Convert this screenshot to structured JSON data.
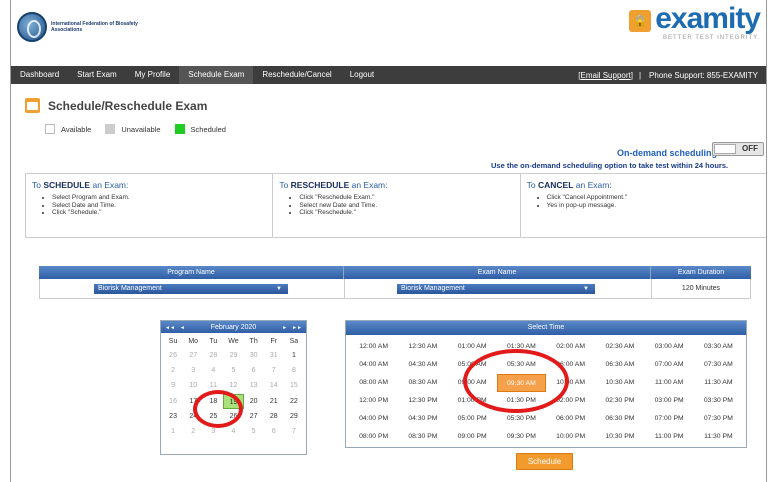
{
  "header": {
    "org_name": "International Federation of Biosafety Associations",
    "brand": "examity",
    "tagline": "BETTER TEST INTEGRITY."
  },
  "nav": {
    "items": [
      "Dashboard",
      "Start Exam",
      "My Profile",
      "Schedule Exam",
      "Reschedule/Cancel",
      "Logout"
    ],
    "active": "Schedule Exam",
    "email_support": "[Email Support]",
    "separator": "|",
    "phone_support": "Phone Support: 855-EXAMITY"
  },
  "page": {
    "title": "Schedule/Reschedule Exam"
  },
  "legend": {
    "available": "Available",
    "unavailable": "Unavailable",
    "scheduled": "Scheduled",
    "colors": {
      "available": "#ffffff",
      "unavailable": "#cccccc",
      "scheduled": "#22cc22"
    }
  },
  "ondemand": {
    "label": "On-demand scheduling",
    "toggle_state": "OFF",
    "note": "Use the on-demand scheduling option to take test within 24 hours."
  },
  "instructions": {
    "schedule": {
      "prefix": "To ",
      "action": "SCHEDULE",
      "suffix": " an Exam:",
      "steps": [
        "Select Program and Exam.",
        "Select Date and Time.",
        "Click \"Schedule.\""
      ]
    },
    "reschedule": {
      "prefix": "To ",
      "action": "RESCHEDULE",
      "suffix": " an Exam:",
      "steps": [
        "Click \"Reschedule Exam.\"",
        "Select new Date and Time.",
        "Click \"Reschedule.\""
      ]
    },
    "cancel": {
      "prefix": "To ",
      "action": "CANCEL",
      "suffix": " an Exam:",
      "steps": [
        "Click \"Cancel Appointment.\"",
        "Yes in pop-up message."
      ]
    }
  },
  "program_table": {
    "headers": [
      "Program Name",
      "Exam Name",
      "Exam Duration"
    ],
    "program_value": "Biorisk Management",
    "exam_value": "Biorisk Management",
    "duration": "120 Minutes"
  },
  "calendar": {
    "month_label": "February 2020",
    "nav_prev_year": "◄◄",
    "nav_prev": "◄",
    "nav_next": "►",
    "nav_next_year": "►►",
    "days_of_week": [
      "Su",
      "Mo",
      "Tu",
      "We",
      "Th",
      "Fr",
      "Sa"
    ],
    "weeks": [
      [
        "26",
        "27",
        "28",
        "29",
        "30",
        "31",
        "1"
      ],
      [
        "2",
        "3",
        "4",
        "5",
        "6",
        "7",
        "8"
      ],
      [
        "9",
        "10",
        "11",
        "12",
        "13",
        "14",
        "15"
      ],
      [
        "16",
        "17",
        "18",
        "19",
        "20",
        "21",
        "22"
      ],
      [
        "23",
        "24",
        "25",
        "26",
        "27",
        "28",
        "29"
      ],
      [
        "1",
        "2",
        "3",
        "4",
        "5",
        "6",
        "7"
      ]
    ],
    "selected": "19"
  },
  "time_select": {
    "header": "Select Time",
    "times": [
      [
        "12:00 AM",
        "12:30 AM",
        "01:00 AM",
        "01:30 AM",
        "02:00 AM",
        "02:30 AM",
        "03:00 AM",
        "03:30 AM"
      ],
      [
        "04:00 AM",
        "04:30 AM",
        "05:00 AM",
        "05:30 AM",
        "06:00 AM",
        "06:30 AM",
        "07:00 AM",
        "07:30 AM"
      ],
      [
        "08:00 AM",
        "08:30 AM",
        "09:00 AM",
        "09:30 AM",
        "10:00 AM",
        "10:30 AM",
        "11:00 AM",
        "11:30 AM"
      ],
      [
        "12:00 PM",
        "12:30 PM",
        "01:00 PM",
        "01:30 PM",
        "02:00 PM",
        "02:30 PM",
        "03:00 PM",
        "03:30 PM"
      ],
      [
        "04:00 PM",
        "04:30 PM",
        "05:00 PM",
        "05:30 PM",
        "06:00 PM",
        "06:30 PM",
        "07:00 PM",
        "07:30 PM"
      ],
      [
        "08:00 PM",
        "08:30 PM",
        "09:00 PM",
        "09:30 PM",
        "10:00 PM",
        "10:30 PM",
        "11:00 PM",
        "11:30 PM"
      ]
    ],
    "selected": "09:30 AM"
  },
  "schedule_button": "Schedule",
  "colors": {
    "accent_orange": "#f39a2d",
    "header_blue": "#2f5ea6",
    "annotation_red": "#e21a1a"
  }
}
